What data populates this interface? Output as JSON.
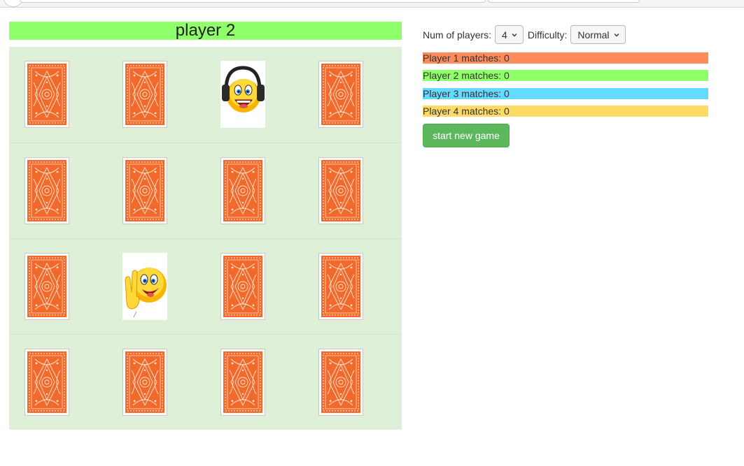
{
  "colors": {
    "current_player_bar": "#8fff6a",
    "board_bg": "#dff0d8",
    "card_back": "#f26a2b",
    "player1": "#ff8a5c",
    "player2": "#8fff6a",
    "player3": "#66d9ff",
    "player4": "#ffdb66",
    "start_button": "#5cb85c"
  },
  "header": {
    "current_player": "player 2"
  },
  "controls": {
    "num_players_label": "Num of players:",
    "num_players_value": "4",
    "difficulty_label": "Difficulty:",
    "difficulty_value": "Normal"
  },
  "scores": [
    {
      "label": "Player 1 matches: 0"
    },
    {
      "label": "Player 2 matches: 0"
    },
    {
      "label": "Player 3 matches: 0"
    },
    {
      "label": "Player 4 matches: 0"
    }
  ],
  "start_button_label": "start new game",
  "board": {
    "rows": [
      [
        "back",
        "back",
        "headphones-smiley",
        "back"
      ],
      [
        "back",
        "back",
        "back",
        "back"
      ],
      [
        "back",
        "peace-smiley",
        "back",
        "back"
      ],
      [
        "back",
        "back",
        "back",
        "back"
      ]
    ]
  }
}
